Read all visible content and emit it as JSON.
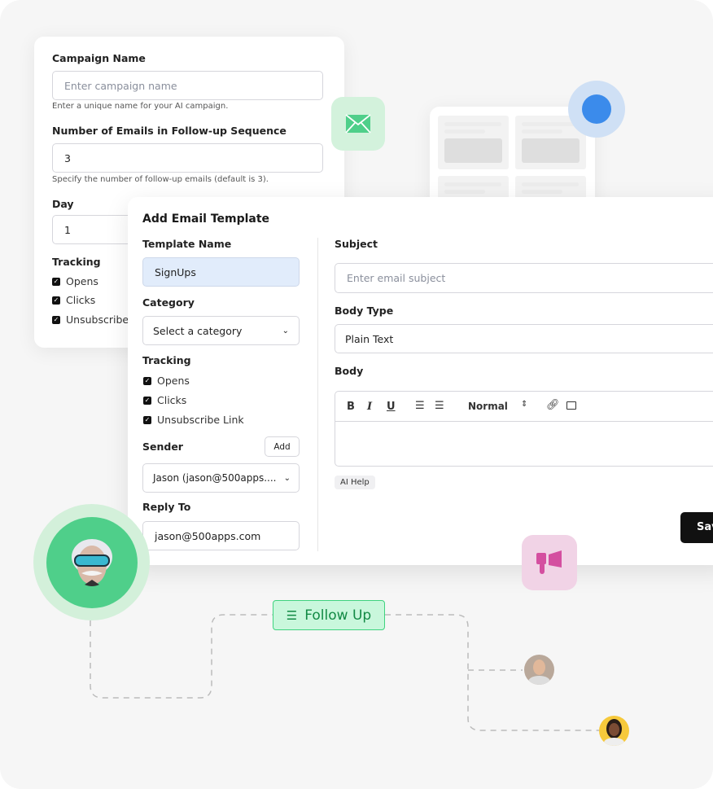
{
  "campaign_form": {
    "campaign_name_label": "Campaign Name",
    "campaign_name_placeholder": "Enter campaign name",
    "campaign_name_help": "Enter a unique name for your AI campaign.",
    "num_emails_label": "Number of Emails in Follow-up Sequence",
    "num_emails_value": "3",
    "num_emails_help": "Specify the number of follow-up emails (default is 3).",
    "day_label": "Day",
    "day_value": "1",
    "tracking_label": "Tracking",
    "tracking": [
      {
        "label": "Opens",
        "checked": true
      },
      {
        "label": "Clicks",
        "checked": true
      },
      {
        "label": "Unsubscribe",
        "checked": true
      }
    ]
  },
  "modal": {
    "title": "Add Email Template",
    "template_name_label": "Template Name",
    "template_name_value": "SignUps",
    "category_label": "Category",
    "category_value": "Select a category",
    "tracking_label": "Tracking",
    "tracking": [
      {
        "label": "Opens",
        "checked": true
      },
      {
        "label": "Clicks",
        "checked": true
      },
      {
        "label": "Unsubscribe Link",
        "checked": true
      }
    ],
    "sender_label": "Sender",
    "add_label": "Add",
    "sender_value": "Jason (jason@500apps....",
    "reply_to_label": "Reply To",
    "reply_to_value": "jason@500apps.com",
    "subject_label": "Subject",
    "subject_placeholder": "Enter email subject",
    "body_type_label": "Body Type",
    "body_type_value": "Plain Text",
    "body_label": "Body",
    "toolbar": {
      "bold": "B",
      "italic": "I",
      "underline": "U",
      "format": "Normal"
    },
    "ai_help_label": "AI Help",
    "save_label": "Save"
  },
  "flow": {
    "follow_up_label": "Follow Up"
  },
  "colors": {
    "green": "#4fcf8a",
    "green_light": "#d3f2dc",
    "pink": "#d44fa0",
    "pink_light": "#f1d3e6",
    "blue": "#3b8beb",
    "blue_light": "#cfe0f5",
    "dark": "#111111"
  }
}
